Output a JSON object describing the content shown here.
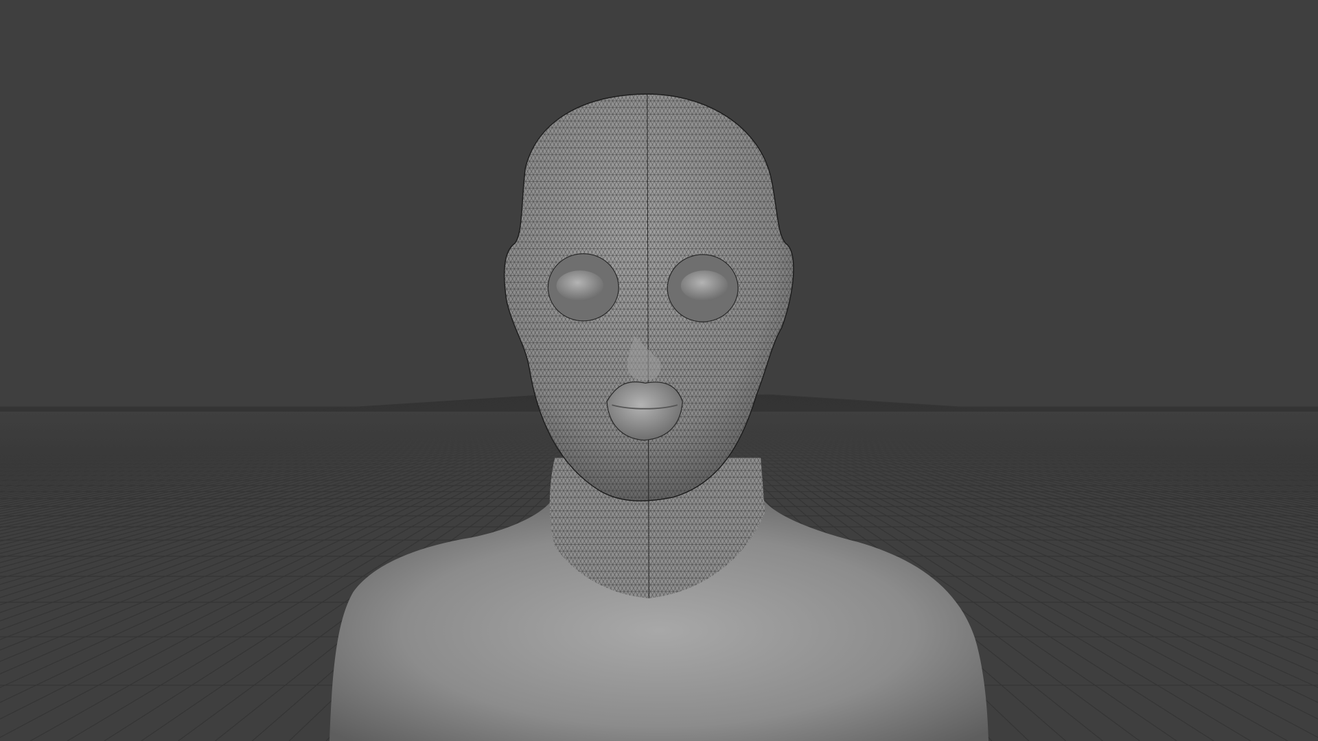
{
  "viewport": {
    "background_color": "#3f3f3f",
    "grid_color": "#353535",
    "mesh_color": "#2a2a2a",
    "skin_color": "#8e8e8e"
  }
}
